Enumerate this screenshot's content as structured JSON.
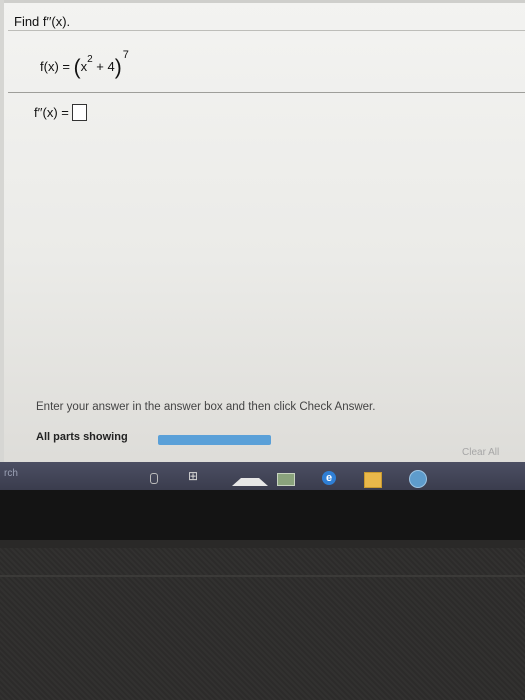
{
  "question": {
    "title": "Find f′′(x).",
    "function_label": "f(x) =",
    "function_inner": "x",
    "function_inner_exp": "2",
    "function_plus": "+ 4",
    "function_outer_exp": "7",
    "answer_label": "f′′(x) ="
  },
  "footer": {
    "instruction": "Enter your answer in the answer box and then click Check Answer.",
    "parts_label": "All parts showing",
    "clear_all": "Clear All"
  },
  "taskbar": {
    "search_fragment": "rch",
    "icons": [
      "microphone-icon",
      "task-view-icon",
      "graduation-cap-icon",
      "mail-icon",
      "edge-icon",
      "store-icon",
      "app-icon"
    ]
  },
  "colors": {
    "progress": "#5aa0d8",
    "taskbar": "#3f4254"
  }
}
